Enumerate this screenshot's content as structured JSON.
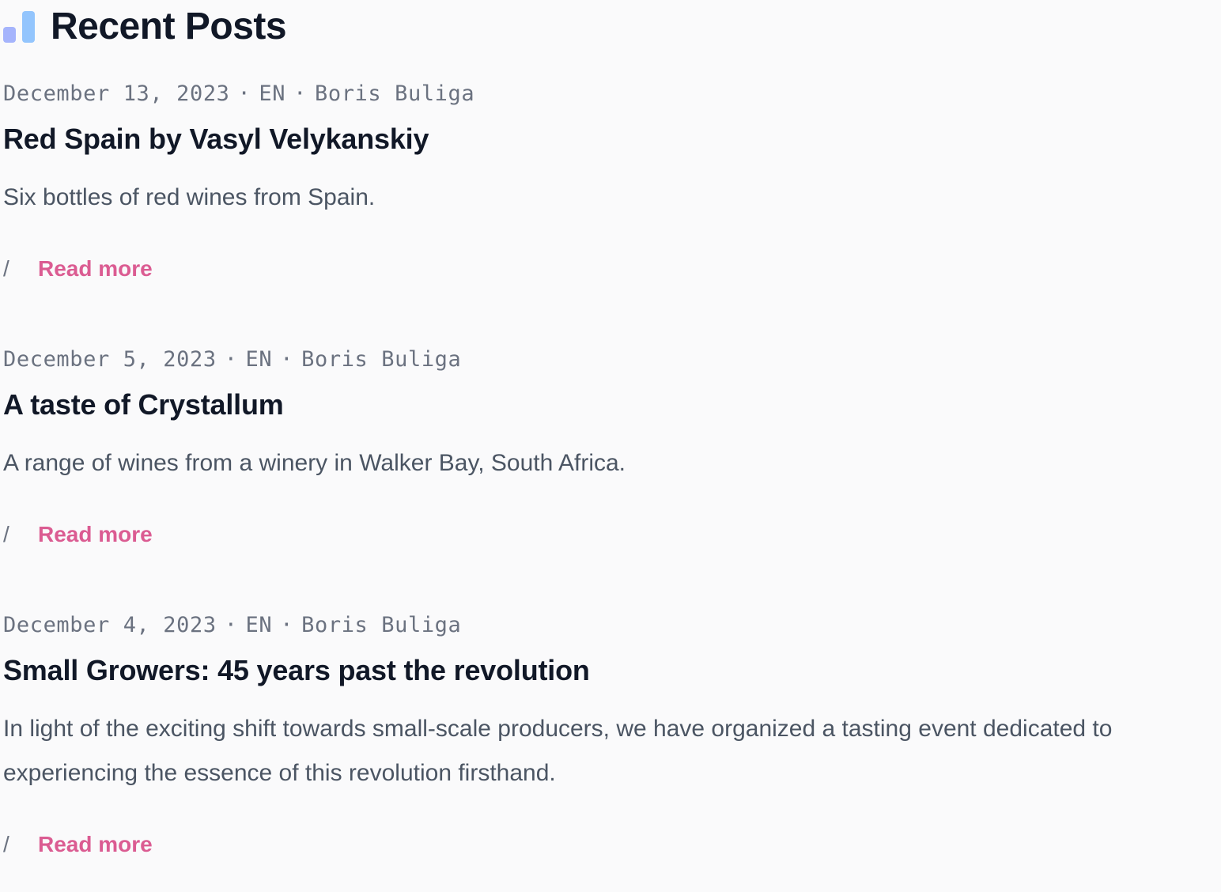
{
  "header": {
    "title": "Recent Posts",
    "icon": "bar-chart-icon",
    "icon_colors": [
      "#a5b4fc",
      "#93c5fd"
    ]
  },
  "accent_color": "#db5c92",
  "read_more_prefix": "/",
  "posts": [
    {
      "date": "December 13, 2023",
      "language": "EN",
      "author": "Boris Buliga",
      "title": "Red Spain by Vasyl Velykanskiy",
      "summary": "Six bottles of red wines from Spain.",
      "read_more": "Read more"
    },
    {
      "date": "December 5, 2023",
      "language": "EN",
      "author": "Boris Buliga",
      "title": "A taste of Crystallum",
      "summary": "A range of wines from a winery in Walker Bay, South Africa.",
      "read_more": "Read more"
    },
    {
      "date": "December 4, 2023",
      "language": "EN",
      "author": "Boris Buliga",
      "title": "Small Growers: 45 years past the revolution",
      "summary": "In light of the exciting shift towards small-scale producers, we have organized a tasting event dedicated to experiencing the essence of this revolution firsthand.",
      "read_more": "Read more"
    }
  ]
}
